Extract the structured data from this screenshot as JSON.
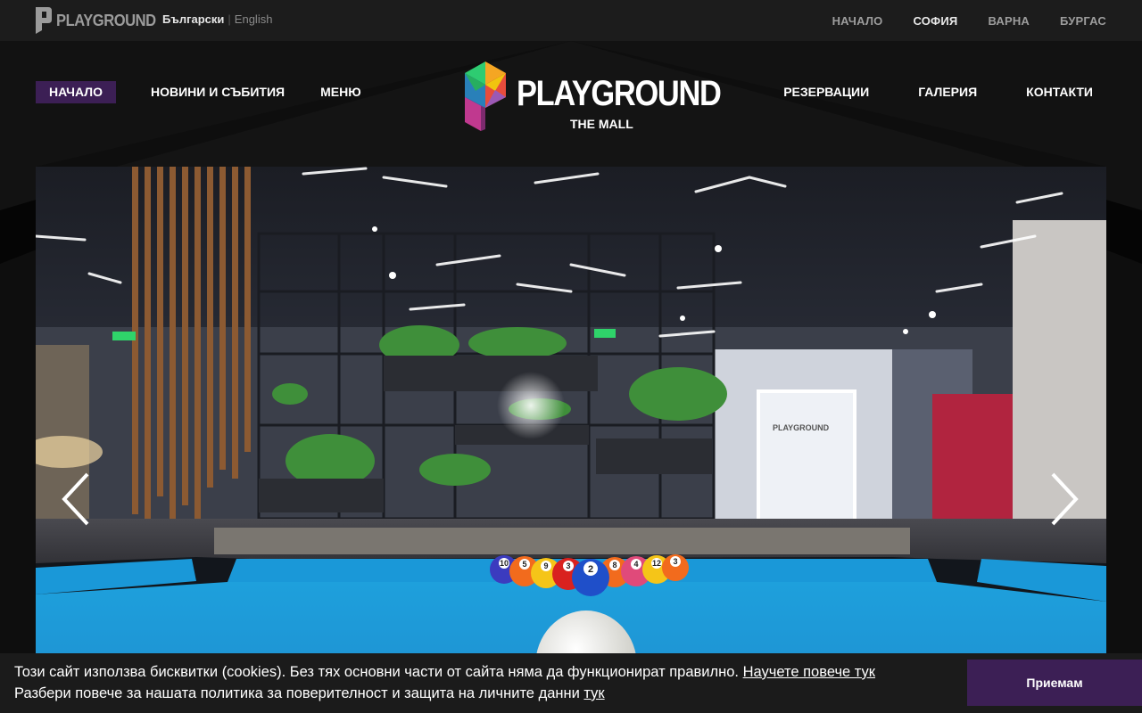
{
  "topbar": {
    "logo_text": "PLAYGROUND",
    "lang_active": "Български",
    "lang_sep": "|",
    "lang_other": "English",
    "cities": [
      {
        "label": "НАЧАЛО"
      },
      {
        "label": "СОФИЯ"
      },
      {
        "label": "ВАРНА"
      },
      {
        "label": "БУРГАС"
      }
    ]
  },
  "nav": {
    "left": [
      {
        "label": "НАЧАЛО"
      },
      {
        "label": "НОВИНИ И СЪБИТИЯ"
      },
      {
        "label": "МЕНЮ"
      }
    ],
    "right": [
      {
        "label": "РЕЗЕРВАЦИИ"
      },
      {
        "label": "ГАЛЕРИЯ"
      },
      {
        "label": "КОНТАКТИ"
      }
    ]
  },
  "brand": {
    "name": "PLAYGROUND",
    "sub": "THE MALL"
  },
  "hero": {
    "sign_text": "PLAYGROUND",
    "ball_numbers": [
      "10",
      "5",
      "9",
      "3",
      "2",
      "8",
      "4",
      "12",
      "3"
    ]
  },
  "cookie": {
    "line1": "Този сайт използва бисквитки (cookies). Без тях основни части от сайта няма да функционират правилно.",
    "line1_link": "Научете повече тук",
    "line2": "Разбери повече за нашата политика за поверителност и защита на личните данни",
    "line2_link": "тук",
    "accept": "Приемам"
  },
  "colors": {
    "accent": "#3c1f55",
    "table_felt": "#1aa7e0"
  }
}
